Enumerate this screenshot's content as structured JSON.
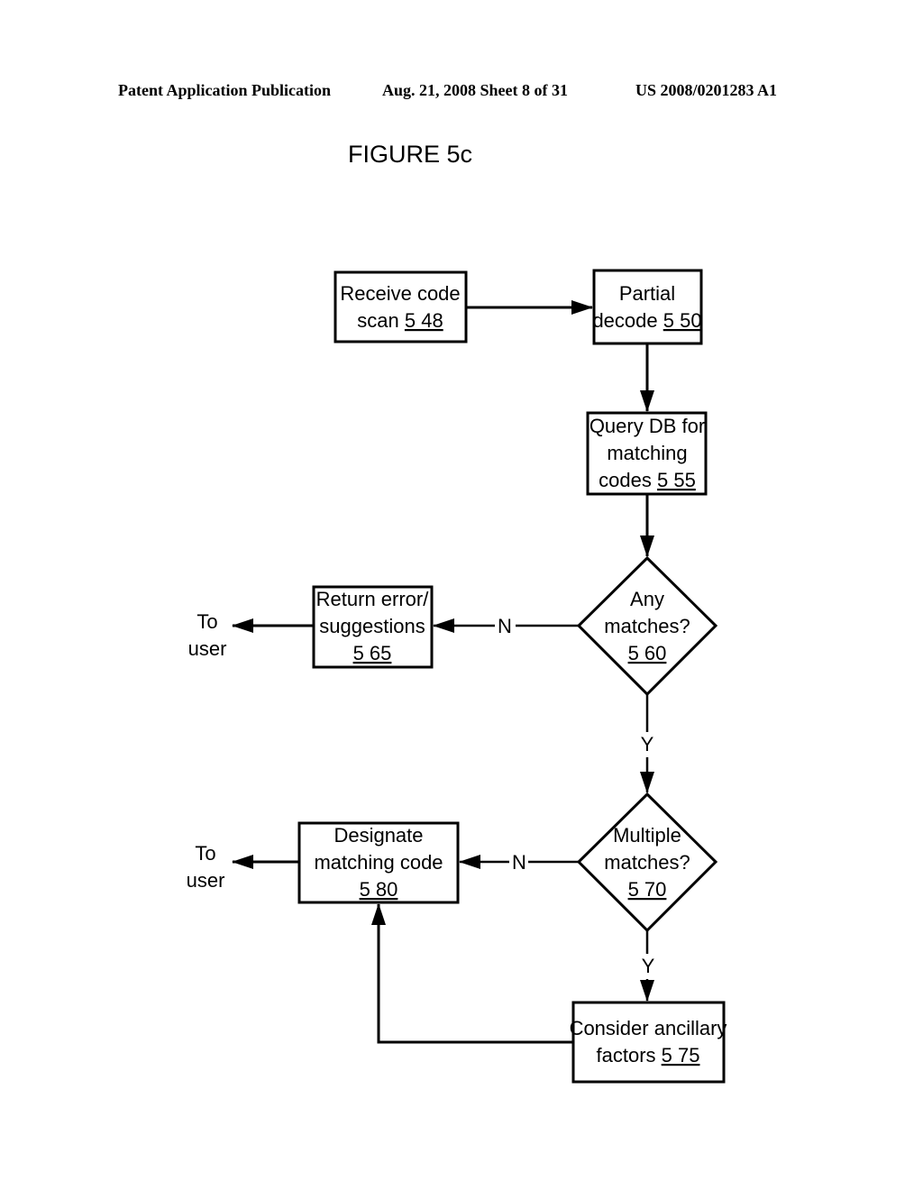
{
  "header": {
    "left": "Patent Application Publication",
    "center": "Aug. 21, 2008  Sheet 8 of 31",
    "right": "US 2008/0201283 A1"
  },
  "figure_title": "FIGURE 5c",
  "nodes": {
    "receive": {
      "lines": [
        "Receive code",
        "scan "
      ],
      "ref": "5 48"
    },
    "partial": {
      "lines": [
        "Partial",
        "decode "
      ],
      "ref": "5 50"
    },
    "query": {
      "lines": [
        "Query DB for",
        "matching",
        "codes  "
      ],
      "ref": "5 55"
    },
    "any": {
      "lines": [
        "Any",
        "matches?"
      ],
      "ref": "5 60"
    },
    "error": {
      "lines": [
        "Return error/",
        "suggestions"
      ],
      "ref": "5 65"
    },
    "multiple": {
      "lines": [
        "Multiple",
        "matches?"
      ],
      "ref": "5 70"
    },
    "designate": {
      "lines": [
        "Designate",
        "matching code"
      ],
      "ref": "5 80"
    },
    "consider": {
      "lines": [
        "Consider ancillary",
        "factors "
      ],
      "ref": "5 75"
    }
  },
  "edge_labels": {
    "any_no": "N",
    "any_yes": "Y",
    "multiple_no": "N",
    "multiple_yes": "Y"
  },
  "terminals": {
    "to_user_1": [
      "To",
      "user"
    ],
    "to_user_2": [
      "To",
      "user"
    ]
  }
}
